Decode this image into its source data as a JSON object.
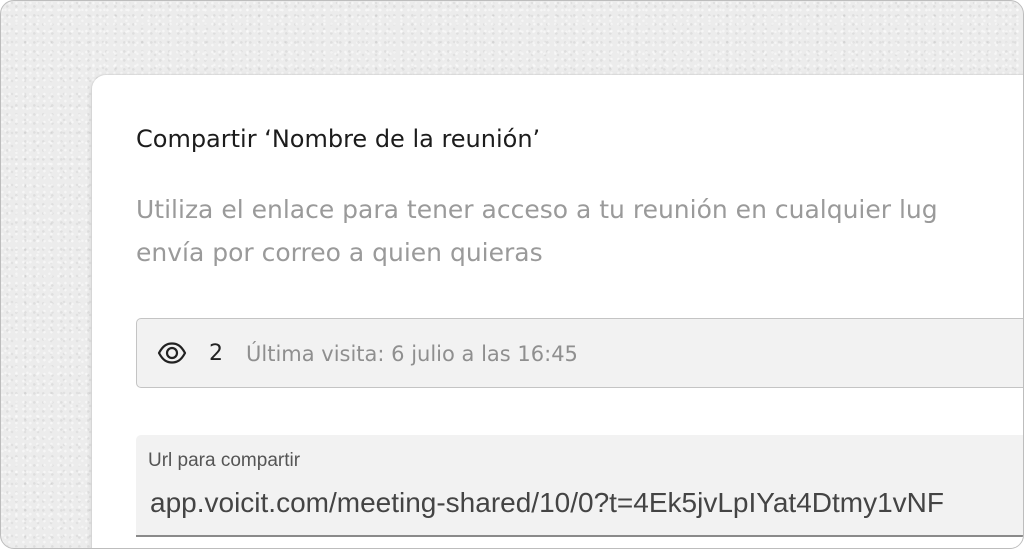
{
  "dialog": {
    "title": "Compartir ‘Nombre de la reunión’",
    "description_line1": "Utiliza el enlace para tener acceso a tu reunión en cualquier lug",
    "description_line2": "envía por correo a quien quieras"
  },
  "visits": {
    "icon": "eye-icon",
    "count": "2",
    "last_visit": "Última visita: 6 julio a las 16:45"
  },
  "share_url": {
    "label": "Url para compartir",
    "value": "app.voicit.com/meeting-shared/10/0?t=4Ek5jvLpIYat4Dtmy1vNF"
  },
  "colors": {
    "background": "#ececec",
    "dialog": "#ffffff",
    "title_text": "#1c1c1c",
    "muted_text": "#9a9a9a",
    "field_fill": "#f2f2f2"
  }
}
